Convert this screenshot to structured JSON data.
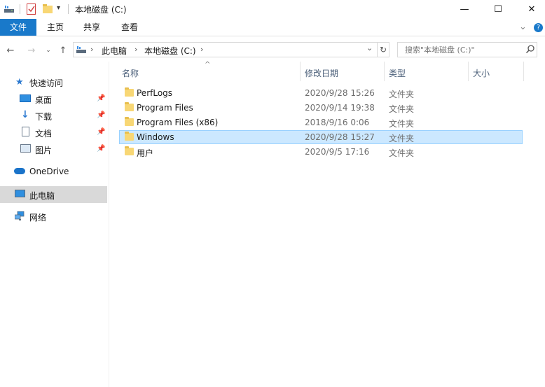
{
  "window": {
    "title": "本地磁盘 (C:)",
    "minimize": "—",
    "maximize": "☐",
    "close": "✕"
  },
  "ribbon": {
    "tabs": [
      {
        "label": "文件"
      },
      {
        "label": "主页"
      },
      {
        "label": "共享"
      },
      {
        "label": "查看"
      }
    ],
    "expand": "⌄",
    "help": "?"
  },
  "address": {
    "crumbs": [
      "此电脑",
      "本地磁盘 (C:)"
    ],
    "search_placeholder": "搜索\"本地磁盘 (C:)\""
  },
  "nav": {
    "quick_access": "快速访问",
    "quick_items": [
      {
        "label": "桌面",
        "icon": "desktop-icon"
      },
      {
        "label": "下载",
        "icon": "download-arrow-icon"
      },
      {
        "label": "文档",
        "icon": "document-icon"
      },
      {
        "label": "图片",
        "icon": "picture-icon"
      }
    ],
    "onedrive": "OneDrive",
    "this_pc": "此电脑",
    "network": "网络"
  },
  "columns": {
    "name": "名称",
    "modified": "修改日期",
    "type": "类型",
    "size": "大小"
  },
  "files": [
    {
      "name": "PerfLogs",
      "modified": "2020/9/28 15:26",
      "type": "文件夹"
    },
    {
      "name": "Program Files",
      "modified": "2020/9/14 19:38",
      "type": "文件夹"
    },
    {
      "name": "Program Files (x86)",
      "modified": "2018/9/16 0:06",
      "type": "文件夹"
    },
    {
      "name": "Windows",
      "modified": "2020/9/28 15:27",
      "type": "文件夹"
    },
    {
      "name": "用户",
      "modified": "2020/9/5 17:16",
      "type": "文件夹"
    }
  ],
  "colors": {
    "accent": "#1979ca",
    "selection": "#cce8ff",
    "selection_border": "#99d1ff",
    "folder": "#f8d775"
  }
}
